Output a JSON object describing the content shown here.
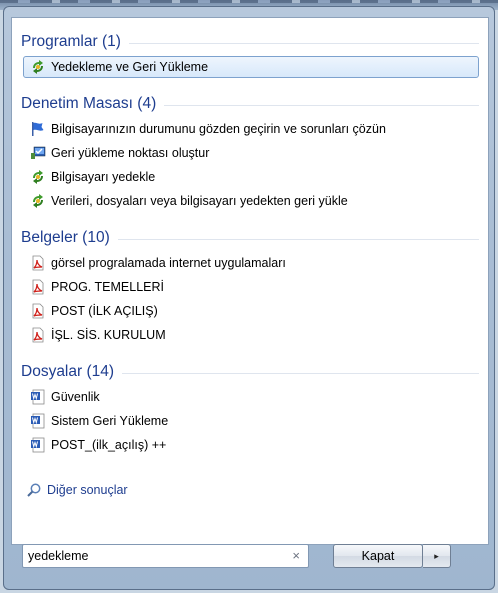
{
  "categories": {
    "programs": {
      "title": "Programlar (1)",
      "items": [
        {
          "label": "Yedekleme ve Geri Yükleme",
          "icon": "backup-restore-icon"
        }
      ]
    },
    "control_panel": {
      "title": "Denetim Masası (4)",
      "items": [
        {
          "label": "Bilgisayarınızın durumunu gözden geçirin ve sorunları çözün",
          "icon": "action-center-flag-icon"
        },
        {
          "label": "Geri yükleme noktası oluştur",
          "icon": "system-restore-icon"
        },
        {
          "label": "Bilgisayarı yedekle",
          "icon": "backup-restore-icon"
        },
        {
          "label": "Verileri, dosyaları veya bilgisayarı yedekten geri yükle",
          "icon": "backup-restore-icon"
        }
      ]
    },
    "documents": {
      "title": "Belgeler (10)",
      "items": [
        {
          "label": "görsel progralamada internet uygulamaları",
          "icon": "pdf-icon"
        },
        {
          "label": "PROG. TEMELLERİ",
          "icon": "pdf-icon"
        },
        {
          "label": "POST (İLK AÇILIŞ)",
          "icon": "pdf-icon"
        },
        {
          "label": "İŞL. SİS. KURULUM",
          "icon": "pdf-icon"
        }
      ]
    },
    "files": {
      "title": "Dosyalar (14)",
      "items": [
        {
          "label": "Güvenlik",
          "icon": "word-document-icon"
        },
        {
          "label": "Sistem Geri Yükleme",
          "icon": "word-document-icon"
        },
        {
          "label": "POST_(ilk_açılış) ++",
          "icon": "word-document-icon"
        }
      ]
    }
  },
  "more_results": "Diğer sonuçlar",
  "search": {
    "value": "yedekleme",
    "clear_glyph": "×"
  },
  "shutdown": {
    "label": "Kapat",
    "arrow": "▸"
  },
  "colors": {
    "category_text": "#1e3d8f",
    "selection_border": "#7da2ce",
    "frame": "#a9bdd4"
  }
}
